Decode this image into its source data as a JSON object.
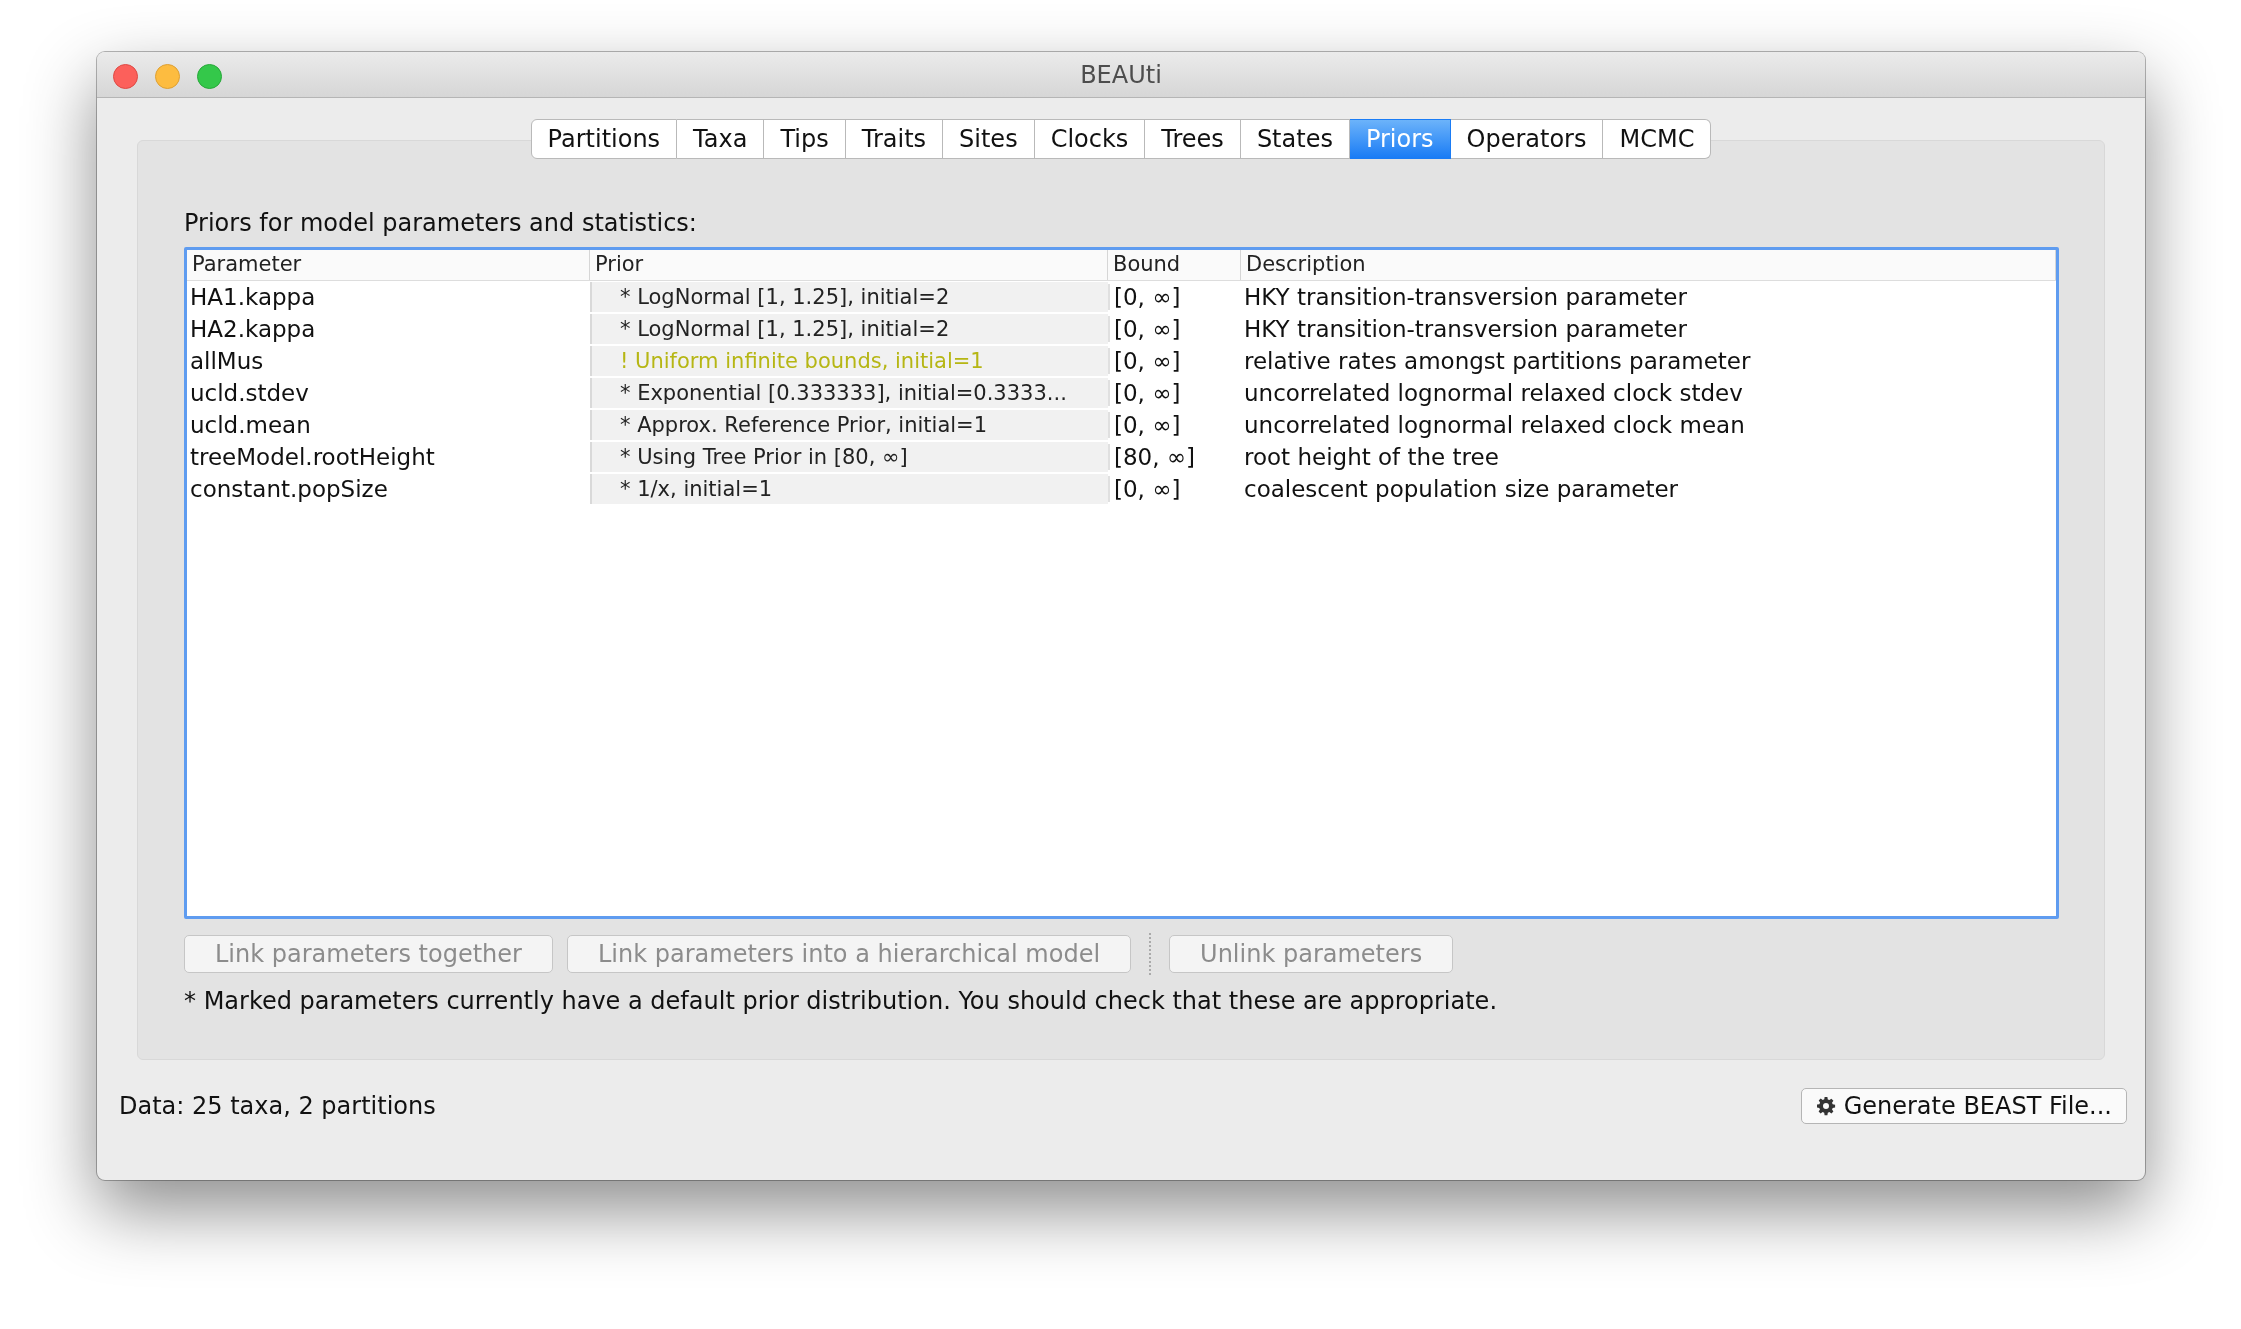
{
  "window": {
    "title": "BEAUti"
  },
  "tabs": [
    {
      "label": "Partitions",
      "selected": false
    },
    {
      "label": "Taxa",
      "selected": false
    },
    {
      "label": "Tips",
      "selected": false
    },
    {
      "label": "Traits",
      "selected": false
    },
    {
      "label": "Sites",
      "selected": false
    },
    {
      "label": "Clocks",
      "selected": false
    },
    {
      "label": "Trees",
      "selected": false
    },
    {
      "label": "States",
      "selected": false
    },
    {
      "label": "Priors",
      "selected": true
    },
    {
      "label": "Operators",
      "selected": false
    },
    {
      "label": "MCMC",
      "selected": false
    }
  ],
  "heading": "Priors for model parameters and statistics:",
  "table": {
    "columns": [
      "Parameter",
      "Prior",
      "Bound",
      "Description"
    ],
    "rows": [
      {
        "parameter": "HA1.kappa",
        "prior": "* LogNormal [1, 1.25], initial=2",
        "warning": false,
        "bound": "[0, ∞]",
        "description": "HKY transition-transversion parameter"
      },
      {
        "parameter": "HA2.kappa",
        "prior": "* LogNormal [1, 1.25], initial=2",
        "warning": false,
        "bound": "[0, ∞]",
        "description": "HKY transition-transversion parameter"
      },
      {
        "parameter": "allMus",
        "prior": "! Uniform infinite bounds, initial=1",
        "warning": true,
        "bound": "[0, ∞]",
        "description": "relative rates amongst partitions parameter"
      },
      {
        "parameter": "ucld.stdev",
        "prior": "* Exponential [0.333333], initial=0.3333...",
        "warning": false,
        "bound": "[0, ∞]",
        "description": "uncorrelated lognormal relaxed clock stdev"
      },
      {
        "parameter": "ucld.mean",
        "prior": "* Approx. Reference Prior, initial=1",
        "warning": false,
        "bound": "[0, ∞]",
        "description": "uncorrelated lognormal relaxed clock mean"
      },
      {
        "parameter": "treeModel.rootHeight",
        "prior": "* Using Tree Prior in [80, ∞]",
        "warning": false,
        "bound": "[80, ∞]",
        "description": "root height of the tree"
      },
      {
        "parameter": "constant.popSize",
        "prior": "* 1/x, initial=1",
        "warning": false,
        "bound": "[0, ∞]",
        "description": "coalescent population size parameter"
      }
    ]
  },
  "buttons": [
    {
      "label": "Link parameters together",
      "disabled": true
    },
    {
      "label": "Link parameters into a hierarchical model",
      "disabled": true
    },
    {
      "label": "Unlink parameters",
      "disabled": true
    }
  ],
  "note": "* Marked parameters currently have a default prior distribution. You should check that these are appropriate.",
  "status_bar": {
    "text": "Data: 25 taxa, 2 partitions",
    "button": "Generate BEAST File..."
  }
}
